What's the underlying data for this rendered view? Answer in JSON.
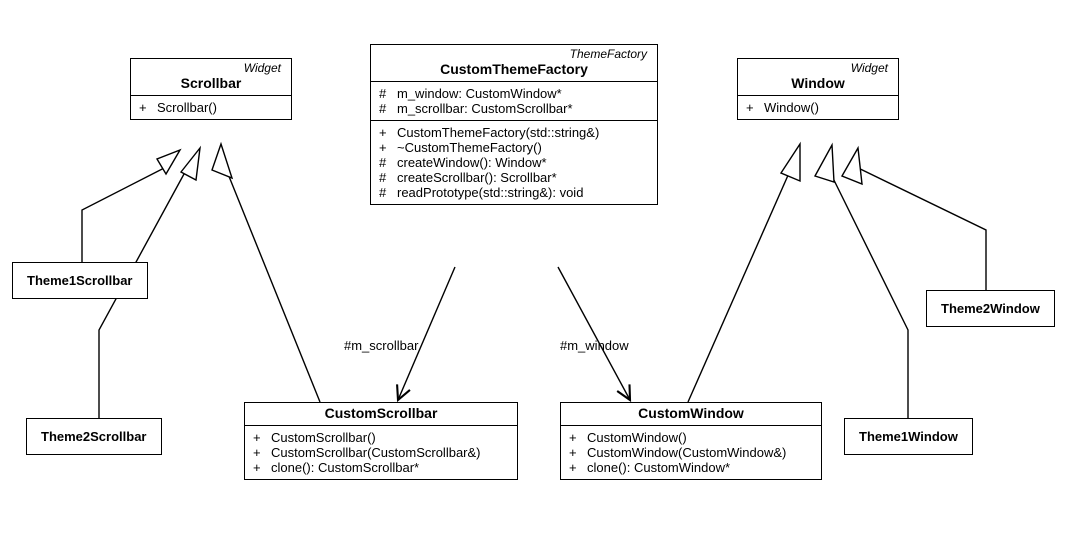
{
  "classes": {
    "scrollbar": {
      "stereotype": "Widget",
      "name": "Scrollbar",
      "ops": [
        {
          "vis": "+",
          "sig": "Scrollbar()"
        }
      ]
    },
    "window": {
      "stereotype": "Widget",
      "name": "Window",
      "ops": [
        {
          "vis": "+",
          "sig": "Window()"
        }
      ]
    },
    "customThemeFactory": {
      "stereotype": "ThemeFactory",
      "name": "CustomThemeFactory",
      "attrs": [
        {
          "vis": "#",
          "sig": "m_window: CustomWindow*"
        },
        {
          "vis": "#",
          "sig": "m_scrollbar: CustomScrollbar*"
        }
      ],
      "ops": [
        {
          "vis": "+",
          "sig": "CustomThemeFactory(std::string&)"
        },
        {
          "vis": "+",
          "sig": "~CustomThemeFactory()"
        },
        {
          "vis": "#",
          "sig": "createWindow(): Window*"
        },
        {
          "vis": "#",
          "sig": "createScrollbar(): Scrollbar*"
        },
        {
          "vis": "#",
          "sig": "readPrototype(std::string&): void"
        }
      ]
    },
    "customScrollbar": {
      "name": "CustomScrollbar",
      "ops": [
        {
          "vis": "+",
          "sig": "CustomScrollbar()"
        },
        {
          "vis": "+",
          "sig": "CustomScrollbar(CustomScrollbar&)"
        },
        {
          "vis": "+",
          "sig": "clone(): CustomScrollbar*"
        }
      ]
    },
    "customWindow": {
      "name": "CustomWindow",
      "ops": [
        {
          "vis": "+",
          "sig": "CustomWindow()"
        },
        {
          "vis": "+",
          "sig": "CustomWindow(CustomWindow&)"
        },
        {
          "vis": "+",
          "sig": "clone(): CustomWindow*"
        }
      ]
    },
    "theme1Scrollbar": {
      "name": "Theme1Scrollbar"
    },
    "theme2Scrollbar": {
      "name": "Theme2Scrollbar"
    },
    "theme1Window": {
      "name": "Theme1Window"
    },
    "theme2Window": {
      "name": "Theme2Window"
    }
  },
  "assocLabels": {
    "mScrollbar": "#m_scrollbar",
    "mWindow": "#m_window"
  },
  "chart_data": {
    "type": "uml-class-diagram",
    "classes": [
      {
        "id": "Scrollbar",
        "stereotype": "Widget",
        "operations": [
          "+ Scrollbar()"
        ]
      },
      {
        "id": "Window",
        "stereotype": "Widget",
        "operations": [
          "+ Window()"
        ]
      },
      {
        "id": "CustomThemeFactory",
        "stereotype": "ThemeFactory",
        "attributes": [
          "# m_window: CustomWindow*",
          "# m_scrollbar: CustomScrollbar*"
        ],
        "operations": [
          "+ CustomThemeFactory(std::string&)",
          "+ ~CustomThemeFactory()",
          "# createWindow(): Window*",
          "# createScrollbar(): Scrollbar*",
          "# readPrototype(std::string&): void"
        ]
      },
      {
        "id": "CustomScrollbar",
        "operations": [
          "+ CustomScrollbar()",
          "+ CustomScrollbar(CustomScrollbar&)",
          "+ clone(): CustomScrollbar*"
        ]
      },
      {
        "id": "CustomWindow",
        "operations": [
          "+ CustomWindow()",
          "+ CustomWindow(CustomWindow&)",
          "+ clone(): CustomWindow*"
        ]
      },
      {
        "id": "Theme1Scrollbar"
      },
      {
        "id": "Theme2Scrollbar"
      },
      {
        "id": "Theme1Window"
      },
      {
        "id": "Theme2Window"
      }
    ],
    "relationships": [
      {
        "type": "generalization",
        "from": "Theme1Scrollbar",
        "to": "Scrollbar"
      },
      {
        "type": "generalization",
        "from": "Theme2Scrollbar",
        "to": "Scrollbar"
      },
      {
        "type": "generalization",
        "from": "CustomScrollbar",
        "to": "Scrollbar"
      },
      {
        "type": "generalization",
        "from": "Theme1Window",
        "to": "Window"
      },
      {
        "type": "generalization",
        "from": "Theme2Window",
        "to": "Window"
      },
      {
        "type": "generalization",
        "from": "CustomWindow",
        "to": "Window"
      },
      {
        "type": "association-nav",
        "from": "CustomThemeFactory",
        "to": "CustomScrollbar",
        "label": "#m_scrollbar"
      },
      {
        "type": "association-nav",
        "from": "CustomThemeFactory",
        "to": "CustomWindow",
        "label": "#m_window"
      }
    ]
  }
}
